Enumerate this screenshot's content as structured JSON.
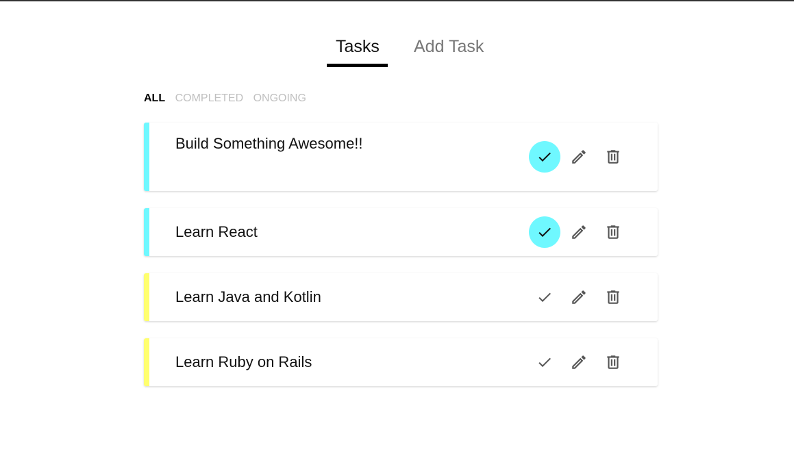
{
  "tabs": [
    {
      "label": "Tasks",
      "active": true
    },
    {
      "label": "Add Task",
      "active": false
    }
  ],
  "filters": [
    {
      "label": "ALL",
      "active": true
    },
    {
      "label": "COMPLETED",
      "active": false
    },
    {
      "label": "ONGOING",
      "active": false
    }
  ],
  "tasks": [
    {
      "title": "Build Something Awesome!!",
      "completed": true,
      "stripe_color": "#6ff8ff"
    },
    {
      "title": "Learn React",
      "completed": true,
      "stripe_color": "#6ff8ff"
    },
    {
      "title": "Learn Java and Kotlin",
      "completed": false,
      "stripe_color": "#ffff6f"
    },
    {
      "title": "Learn Ruby on Rails",
      "completed": false,
      "stripe_color": "#ffff6f"
    }
  ],
  "icons": {
    "complete": "check-icon",
    "edit": "pencil-icon",
    "delete": "trash-icon"
  },
  "colors": {
    "completed_stripe": "#6ff8ff",
    "ongoing_stripe": "#ffff6f",
    "completed_button_bg": "#6ff8ff",
    "icon": "#555555",
    "active_tab": "#111111",
    "inactive_tab": "#777777",
    "inactive_filter": "#c0c0c0"
  }
}
